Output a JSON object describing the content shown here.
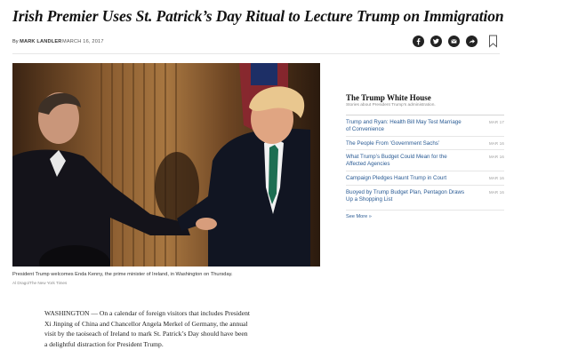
{
  "article": {
    "headline": "Irish Premier Uses St. Patrick’s Day Ritual to Lecture Trump on Immigration",
    "byline_prefix": "By",
    "author": "MARK LANDLER",
    "date": "MARCH 16, 2017"
  },
  "share_icons": [
    "facebook-icon",
    "twitter-icon",
    "email-icon",
    "share-arrow-icon",
    "bookmark-icon"
  ],
  "photo": {
    "caption": "President Trump welcomes Enda Kenny, the prime minister of Ireland, in Washington on Thursday.",
    "credit": "Al Drago/The New York Times"
  },
  "body": {
    "lines": [
      "WASHINGTON — On a calendar of foreign visitors that includes President",
      "Xi Jinping of China and Chancellor Angela Merkel of Germany, the annual",
      "visit by the taoiseach of Ireland to mark St. Patrick’s Day should have been",
      "a delightful distraction for President Trump."
    ]
  },
  "sidebar": {
    "title": "The Trump White House",
    "subtitle": "Stories about President Trump’s administration.",
    "items": [
      {
        "line1": "Trump and Ryan: Health Bill May Test Marriage",
        "line2": "of Convenience",
        "date": "MAR 17"
      },
      {
        "line1": "The People From ‘Government Sachs’",
        "line2": "",
        "date": "MAR 16"
      },
      {
        "line1": "What Trump’s Budget Could Mean for the",
        "line2": "Affected Agencies",
        "date": "MAR 16"
      },
      {
        "line1": "Campaign Pledges Haunt Trump in Court",
        "line2": "",
        "date": "MAR 16"
      },
      {
        "line1": "Buoyed by Trump Budget Plan, Pentagon Draws",
        "line2": "Up a Shopping List",
        "date": "MAR 16"
      }
    ],
    "see_more": "See More »"
  },
  "colors": {
    "link": "#2a5b94",
    "icon_fill": "#222222",
    "rule": "#e6e6e6"
  }
}
